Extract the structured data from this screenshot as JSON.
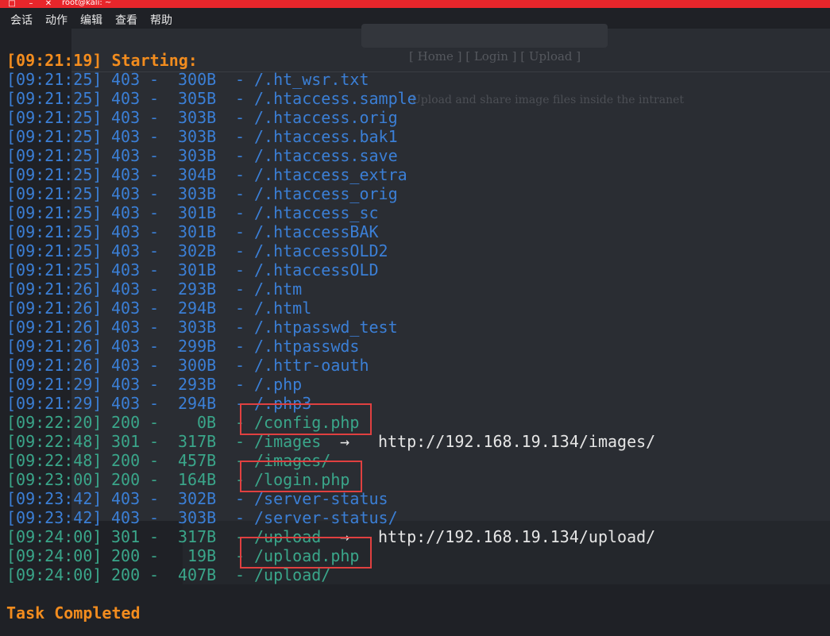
{
  "window": {
    "title": "root@kali: ~",
    "close_glyph": "✕",
    "minimize_glyph": "–",
    "restore_glyph": "□"
  },
  "menubar": [
    "会话",
    "动作",
    "编辑",
    "查看",
    "帮助"
  ],
  "background_page": {
    "nav": "[ Home ] [ Login ] [ Upload ]",
    "text": "Upload and share image files inside the intranet"
  },
  "terminal": {
    "start_line": "[09:21:19] Starting:",
    "entries": [
      {
        "ts": "[09:21:25]",
        "code": "403",
        "size": "300B",
        "path": "/.ht_wsr.txt"
      },
      {
        "ts": "[09:21:25]",
        "code": "403",
        "size": "305B",
        "path": "/.htaccess.sample"
      },
      {
        "ts": "[09:21:25]",
        "code": "403",
        "size": "303B",
        "path": "/.htaccess.orig"
      },
      {
        "ts": "[09:21:25]",
        "code": "403",
        "size": "303B",
        "path": "/.htaccess.bak1"
      },
      {
        "ts": "[09:21:25]",
        "code": "403",
        "size": "303B",
        "path": "/.htaccess.save"
      },
      {
        "ts": "[09:21:25]",
        "code": "403",
        "size": "304B",
        "path": "/.htaccess_extra"
      },
      {
        "ts": "[09:21:25]",
        "code": "403",
        "size": "303B",
        "path": "/.htaccess_orig"
      },
      {
        "ts": "[09:21:25]",
        "code": "403",
        "size": "301B",
        "path": "/.htaccess_sc"
      },
      {
        "ts": "[09:21:25]",
        "code": "403",
        "size": "301B",
        "path": "/.htaccessBAK"
      },
      {
        "ts": "[09:21:25]",
        "code": "403",
        "size": "302B",
        "path": "/.htaccessOLD2"
      },
      {
        "ts": "[09:21:25]",
        "code": "403",
        "size": "301B",
        "path": "/.htaccessOLD"
      },
      {
        "ts": "[09:21:26]",
        "code": "403",
        "size": "293B",
        "path": "/.htm"
      },
      {
        "ts": "[09:21:26]",
        "code": "403",
        "size": "294B",
        "path": "/.html"
      },
      {
        "ts": "[09:21:26]",
        "code": "403",
        "size": "303B",
        "path": "/.htpasswd_test"
      },
      {
        "ts": "[09:21:26]",
        "code": "403",
        "size": "299B",
        "path": "/.htpasswds"
      },
      {
        "ts": "[09:21:26]",
        "code": "403",
        "size": "300B",
        "path": "/.httr-oauth"
      },
      {
        "ts": "[09:21:29]",
        "code": "403",
        "size": "293B",
        "path": "/.php"
      },
      {
        "ts": "[09:21:29]",
        "code": "403",
        "size": "294B",
        "path": "/.php3"
      },
      {
        "ts": "[09:22:20]",
        "code": "200",
        "size": "0B",
        "path": "/config.php"
      },
      {
        "ts": "[09:22:48]",
        "code": "301",
        "size": "317B",
        "path": "/images",
        "redirect": "http://192.168.19.134/images/"
      },
      {
        "ts": "[09:22:48]",
        "code": "200",
        "size": "457B",
        "path": "/images/"
      },
      {
        "ts": "[09:23:00]",
        "code": "200",
        "size": "164B",
        "path": "/login.php"
      },
      {
        "ts": "[09:23:42]",
        "code": "403",
        "size": "302B",
        "path": "/server-status"
      },
      {
        "ts": "[09:23:42]",
        "code": "403",
        "size": "303B",
        "path": "/server-status/"
      },
      {
        "ts": "[09:24:00]",
        "code": "301",
        "size": "317B",
        "path": "/upload",
        "redirect": "http://192.168.19.134/upload/"
      },
      {
        "ts": "[09:24:00]",
        "code": "200",
        "size": "19B",
        "path": "/upload.php"
      },
      {
        "ts": "[09:24:00]",
        "code": "200",
        "size": "407B",
        "path": "/upload/"
      }
    ],
    "dash": "-",
    "arrow": "→",
    "end_line": "Task Completed",
    "highlighted_paths": [
      "/config.php",
      "/login.php",
      "/upload.php"
    ]
  },
  "colors": {
    "titlebar": "#e8262b",
    "status_403": "#3b7fd6",
    "status_200": "#3aa68a",
    "header": "#f28c1e",
    "highlight_box": "#e04040"
  }
}
